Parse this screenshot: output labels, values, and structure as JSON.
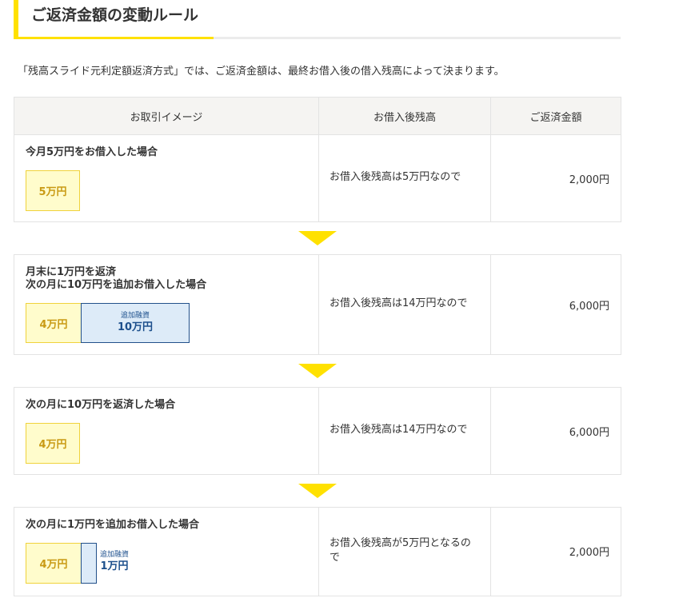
{
  "heading": {
    "title": "ご返済金額の変動ルール"
  },
  "intro": "「残高スライド元利定額返済方式」では、ご返済金額は、最終お借入後の借入残高によって決まります。",
  "table": {
    "headers": [
      "お取引イメージ",
      "お借入後残高",
      "ご返済金額"
    ],
    "rows": [
      {
        "scenario": "今月5万円をお借入した場合",
        "current_box": "5万円",
        "balance_text": "お借入後残高は5万円なので",
        "amount": "2,000円"
      },
      {
        "scenario_line1": "月末に1万円を返済",
        "scenario_line2": "次の月に10万円を追加お借入した場合",
        "current_box": "4万円",
        "additional_label": "追加融資",
        "additional_amount": "10万円",
        "balance_text": "お借入後残高は14万円なので",
        "amount": "6,000円"
      },
      {
        "scenario": "次の月に10万円を返済した場合",
        "current_box": "4万円",
        "balance_text": "お借入後残高は14万円なので",
        "amount": "6,000円"
      },
      {
        "scenario": "次の月に1万円を追加お借入した場合",
        "current_box": "4万円",
        "additional_label": "追加融資",
        "additional_amount": "1万円",
        "balance_text": "お借入後残高が5万円となるので",
        "amount": "2,000円"
      }
    ]
  },
  "colors": {
    "accent_yellow": "#ffe100",
    "box_yellow_fill": "#fffccc",
    "box_yellow_text": "#c99a14",
    "box_blue_fill": "#ddebf8",
    "box_blue_text": "#1c4f8c",
    "header_bg": "#f5f4f2"
  },
  "icons": {
    "step_arrow": "down-triangle-icon"
  }
}
